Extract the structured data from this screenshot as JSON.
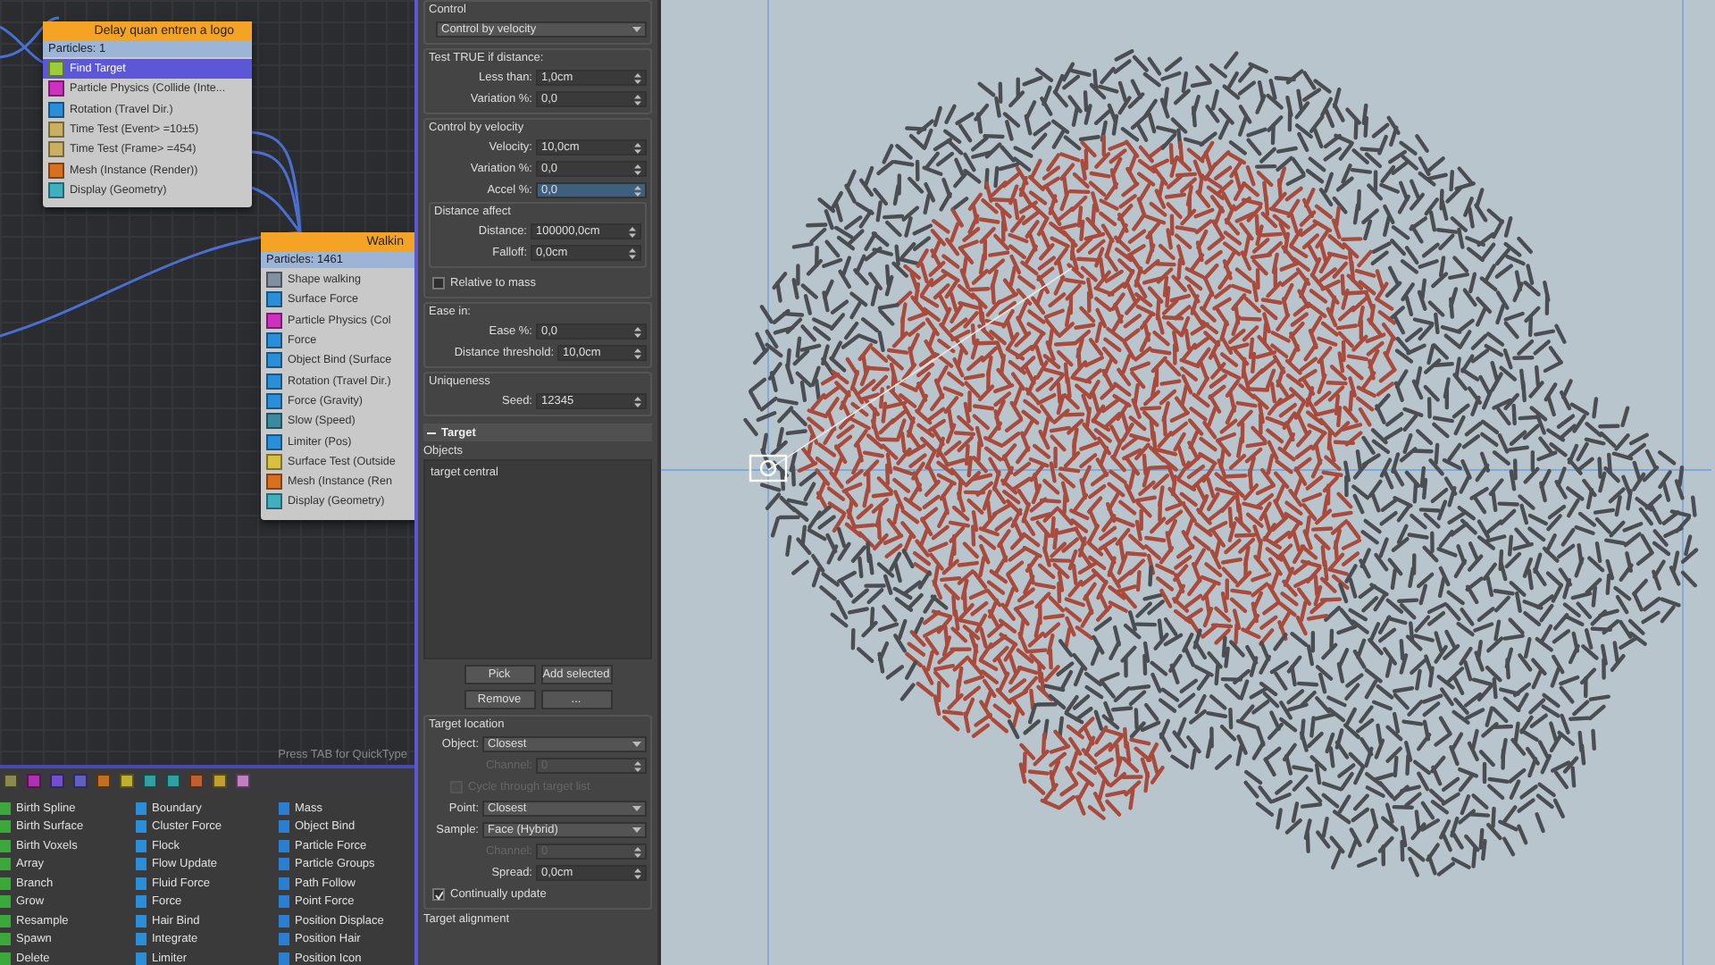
{
  "node_editor": {
    "nodes": [
      {
        "title": "Delay quan entren a logo",
        "particles": "Particles: 1",
        "operators": [
          {
            "label": "Find Target",
            "selected": true,
            "color": "#9ccc3a"
          },
          {
            "label": "Particle Physics (Collide (Inte...",
            "selected": false,
            "color": "#d030c0"
          },
          {
            "label": "Rotation (Travel Dir.)",
            "selected": false,
            "color": "#2a8fd8"
          },
          {
            "label": "Time Test (Event> =10±5)",
            "selected": false,
            "color": "#c8b060"
          },
          {
            "label": "Time Test (Frame> =454)",
            "selected": false,
            "color": "#c8b060"
          },
          {
            "label": "Mesh (Instance (Render))",
            "selected": false,
            "color": "#d87020"
          },
          {
            "label": "Display (Geometry)",
            "selected": false,
            "color": "#40b0c0"
          }
        ]
      },
      {
        "title": "Walkin",
        "particles": "Particles: 1461",
        "operators": [
          {
            "label": "Shape walking",
            "selected": false,
            "color": "#8090a0"
          },
          {
            "label": "Surface Force",
            "selected": false,
            "color": "#2a8fd8"
          },
          {
            "label": "Particle Physics (Col",
            "selected": false,
            "color": "#d030c0"
          },
          {
            "label": "Force",
            "selected": false,
            "color": "#2a8fd8"
          },
          {
            "label": "Object Bind (Surface",
            "selected": false,
            "color": "#2a8fd8"
          },
          {
            "label": "Rotation (Travel Dir.)",
            "selected": false,
            "color": "#2a8fd8"
          },
          {
            "label": "Force (Gravity)",
            "selected": false,
            "color": "#2a8fd8"
          },
          {
            "label": "Slow (Speed)",
            "selected": false,
            "color": "#3a8aa0"
          },
          {
            "label": "Limiter (Pos)",
            "selected": false,
            "color": "#2a8fd8"
          },
          {
            "label": "Surface Test (Outside",
            "selected": false,
            "color": "#d8c040"
          },
          {
            "label": "Mesh (Instance (Ren",
            "selected": false,
            "color": "#d87020"
          },
          {
            "label": "Display (Geometry)",
            "selected": false,
            "color": "#40b0c0"
          }
        ]
      }
    ],
    "hint": "Press TAB for QuickType"
  },
  "depot": {
    "columns": [
      {
        "color": "#3aa83a",
        "items": [
          "Birth Spline",
          "Birth Surface",
          "Birth Voxels",
          "Array",
          "Branch",
          "Grow",
          "Resample",
          "Spawn",
          "Delete"
        ]
      },
      {
        "color": "#2a8fd8",
        "items": [
          "Boundary",
          "Cluster Force",
          "Flock",
          "Flow Update",
          "Fluid Force",
          "Force",
          "Hair Bind",
          "Integrate",
          "Limiter"
        ]
      },
      {
        "color": "#2a7fd0",
        "items": [
          "Mass",
          "Object Bind",
          "Particle Force",
          "Particle Groups",
          "Path Follow",
          "Point Force",
          "Position Displace",
          "Position Hair",
          "Position Icon"
        ]
      }
    ]
  },
  "panel": {
    "sections": [
      {
        "title": "Control",
        "rows": [
          {
            "kind": "dropdown",
            "value": "Control by velocity",
            "disabled": false
          }
        ]
      },
      {
        "title": "Test TRUE if distance:",
        "rows": [
          {
            "kind": "spinner",
            "label": "Less than:",
            "value": "1,0cm",
            "focused": false,
            "disabled": false
          },
          {
            "kind": "spinner",
            "label": "Variation %:",
            "value": "0,0",
            "focused": false,
            "disabled": false
          }
        ]
      },
      {
        "title": "Control by velocity",
        "rows": [
          {
            "kind": "spinner",
            "label": "Velocity:",
            "value": "10,0cm",
            "focused": false,
            "disabled": false
          },
          {
            "kind": "spinner",
            "label": "Variation %:",
            "value": "0,0",
            "focused": false,
            "disabled": false
          },
          {
            "kind": "spinner",
            "label": "Accel %:",
            "value": "0,0",
            "focused": true,
            "disabled": false
          },
          {
            "kind": "group",
            "title": "Distance affect",
            "rows": [
              {
                "kind": "spinner",
                "label": "Distance:",
                "value": "100000,0cm",
                "focused": false,
                "disabled": false
              },
              {
                "kind": "spinner",
                "label": "Falloff:",
                "value": "0,0cm",
                "focused": false,
                "disabled": false
              }
            ]
          },
          {
            "kind": "checkbox",
            "label": "Relative to mass",
            "checked": false,
            "disabled": false
          }
        ]
      },
      {
        "title": "Ease in:",
        "rows": [
          {
            "kind": "spinner",
            "label": "Ease %:",
            "value": "0,0",
            "focused": false,
            "disabled": false
          },
          {
            "kind": "spinner",
            "label": "Distance threshold:",
            "value": "10,0cm",
            "focused": false,
            "disabled": false
          }
        ]
      },
      {
        "title": "Uniqueness",
        "rows": [
          {
            "kind": "spinner",
            "label": "Seed:",
            "value": "12345",
            "focused": false,
            "disabled": false
          }
        ]
      }
    ],
    "rollout": {
      "title": "Target",
      "expanded": true,
      "objects_label": "Objects",
      "objects": [
        "target central"
      ],
      "buttons": [
        "Pick",
        "Add selected",
        "Remove",
        "..."
      ],
      "location": {
        "title": "Target location",
        "rows": [
          {
            "kind": "dropdown",
            "label": "Object:",
            "value": "Closest",
            "disabled": false
          },
          {
            "kind": "spinner",
            "label": "Channel:",
            "value": "0",
            "focused": false,
            "disabled": true
          },
          {
            "kind": "checkbox",
            "label": "Cycle through target list",
            "checked": false,
            "disabled": true
          },
          {
            "kind": "dropdown",
            "label": "Point:",
            "value": "Closest",
            "disabled": false
          },
          {
            "kind": "dropdown",
            "label": "Sample:",
            "value": "Face (Hybrid)",
            "disabled": false
          },
          {
            "kind": "spinner",
            "label": "Channel:",
            "value": "0",
            "focused": false,
            "disabled": true
          },
          {
            "kind": "spinner",
            "label": "Spread:",
            "value": "0,0cm",
            "focused": false,
            "disabled": false
          },
          {
            "kind": "checkbox",
            "label": "Continually update",
            "checked": true,
            "disabled": false
          }
        ]
      },
      "next_title": "Target alignment"
    }
  }
}
